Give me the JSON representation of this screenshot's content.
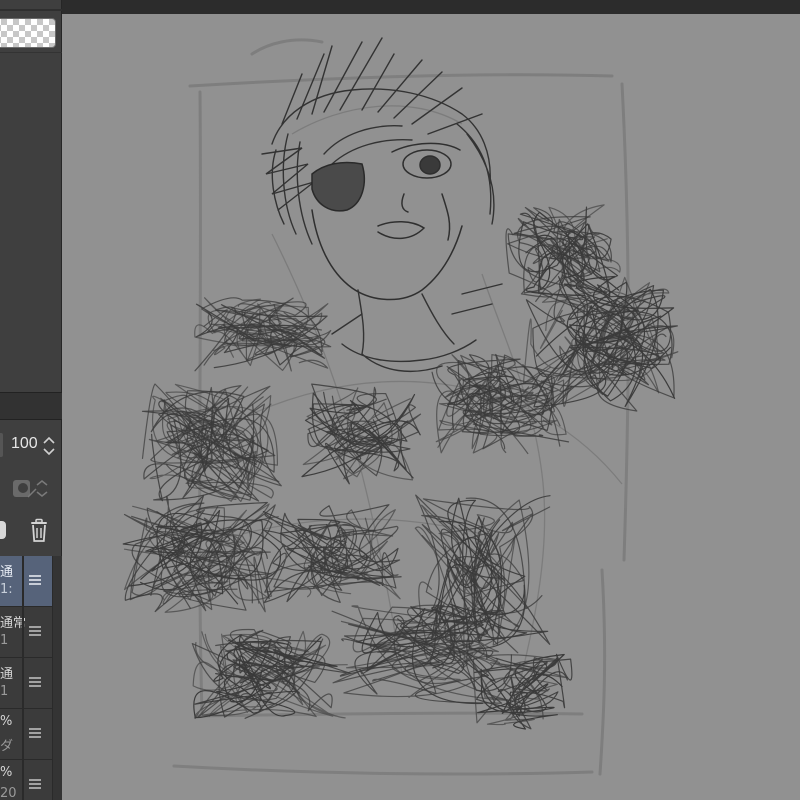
{
  "layer_panel": {
    "opacity_value": "100",
    "layers": [
      {
        "line1": "通",
        "line2": "1:",
        "selected": true
      },
      {
        "line1": "通常",
        "line2": "1",
        "selected": false
      },
      {
        "line1": "通",
        "line2": "1",
        "selected": false
      },
      {
        "line1": "%",
        "line2": "ダ",
        "selected": false
      },
      {
        "line1": "%",
        "line2": "20",
        "selected": false
      }
    ]
  },
  "icons": {
    "opacity_spinner": "chevron-up-down-icon",
    "clipping": "clipping-mask-icon",
    "delete": "trash-icon",
    "layer_menu": "hamburger-menu-icon"
  },
  "colors": {
    "canvas_gray": "#919191",
    "selected_layer": "#56637a",
    "sketch_line": "#3a3a3a"
  }
}
